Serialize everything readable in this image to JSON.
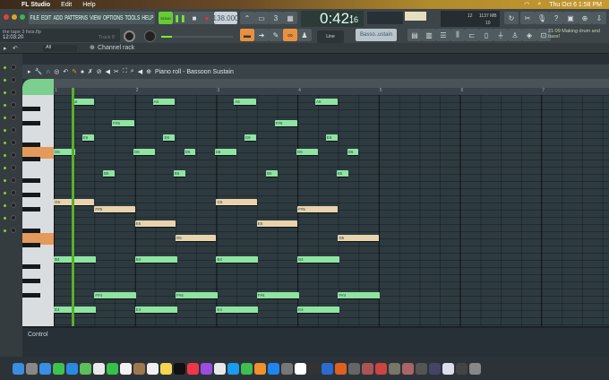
{
  "menubar": {
    "app": "FL Studio",
    "items": [
      "Edit",
      "Help"
    ],
    "datetime": "Thu Oct 6  1:58 PM"
  },
  "main_menu": [
    "FILE",
    "EDIT",
    "ADD",
    "PATTERNS",
    "VIEW",
    "OPTIONS",
    "TOOLS",
    "HELP"
  ],
  "transport": {
    "tempo": "138.000",
    "time": "0:42:",
    "time_small": "16",
    "mode": "SONG"
  },
  "song": {
    "file": "the tape 3 fixis.flp",
    "time": "12:03:20",
    "track": "Track 8"
  },
  "cpu": {
    "voices": "12",
    "memory": "1137 MB",
    "polyphony": "10"
  },
  "snap": "Line",
  "instrument": "Basso..ustain",
  "hint": "21:09  Making drum and bass!",
  "channel_rack": {
    "title": "Channel rack",
    "filter": "All"
  },
  "piano_roll": {
    "title": "Piano roll - Bassoon Sustain",
    "bars": [
      "1",
      "2",
      "3",
      "4",
      "5",
      "6",
      "7"
    ],
    "control_label": "Control"
  },
  "pitches": [
    "A6",
    "G#6",
    "G6",
    "F#6",
    "F6",
    "E6",
    "D#6",
    "D6",
    "C#6",
    "C6",
    "B5",
    "A#5",
    "A5",
    "G#5",
    "G5",
    "F#5",
    "F5",
    "E5",
    "D#5",
    "D5",
    "C#5",
    "C5",
    "B4",
    "A#4",
    "A4",
    "G#4",
    "G4",
    "F#4",
    "F4",
    "E4"
  ],
  "notes": [
    {
      "p": "A6",
      "s": 3.5,
      "l": 4.4,
      "c": "g"
    },
    {
      "p": "A6",
      "s": 19.5,
      "l": 4.4,
      "c": "g"
    },
    {
      "p": "A6",
      "s": 35.5,
      "l": 4.4,
      "c": "g"
    },
    {
      "p": "A6",
      "s": 51.5,
      "l": 4.4,
      "c": "g"
    },
    {
      "p": "F#6",
      "s": 11.5,
      "l": 4.4,
      "c": "g"
    },
    {
      "p": "F#6",
      "s": 43.5,
      "l": 4.4,
      "c": "g"
    },
    {
      "p": "E6",
      "s": 5.6,
      "l": 2.3,
      "c": "g"
    },
    {
      "p": "E6",
      "s": 21.6,
      "l": 2.3,
      "c": "g"
    },
    {
      "p": "E6",
      "s": 37.6,
      "l": 2.3,
      "c": "g"
    },
    {
      "p": "E6",
      "s": 53.6,
      "l": 2.3,
      "c": "g"
    },
    {
      "p": "D6",
      "s": 0,
      "l": 4.3,
      "c": "g"
    },
    {
      "p": "D6",
      "s": 15.7,
      "l": 4.3,
      "c": "g"
    },
    {
      "p": "D6",
      "s": 25.7,
      "l": 2.1,
      "c": "g"
    },
    {
      "p": "D6",
      "s": 31.7,
      "l": 4.3,
      "c": "g"
    },
    {
      "p": "D6",
      "s": 47.8,
      "l": 4.3,
      "c": "g"
    },
    {
      "p": "D6",
      "s": 57.8,
      "l": 2.1,
      "c": "g"
    },
    {
      "p": "B5",
      "s": 9.7,
      "l": 2.3,
      "c": "g"
    },
    {
      "p": "B5",
      "s": 23.6,
      "l": 2.3,
      "c": "g"
    },
    {
      "p": "B5",
      "s": 41.8,
      "l": 2.3,
      "c": "g"
    },
    {
      "p": "B5",
      "s": 55.7,
      "l": 2.3,
      "c": "g"
    },
    {
      "p": "G5",
      "s": 0,
      "l": 8,
      "c": "t"
    },
    {
      "p": "G5",
      "s": 32,
      "l": 8,
      "c": "t"
    },
    {
      "p": "F#5",
      "s": 8,
      "l": 8,
      "c": "t"
    },
    {
      "p": "F#5",
      "s": 48,
      "l": 8,
      "c": "t"
    },
    {
      "p": "E5",
      "s": 16,
      "l": 8,
      "c": "t"
    },
    {
      "p": "E5",
      "s": 40,
      "l": 8,
      "c": "t"
    },
    {
      "p": "D5",
      "s": 24,
      "l": 8,
      "c": "t"
    },
    {
      "p": "D5",
      "s": 56,
      "l": 8,
      "c": "t"
    },
    {
      "p": "B4",
      "s": 0,
      "l": 8.3,
      "c": "g"
    },
    {
      "p": "B4",
      "s": 16,
      "l": 8.3,
      "c": "g"
    },
    {
      "p": "B4",
      "s": 32,
      "l": 8.3,
      "c": "g"
    },
    {
      "p": "B4",
      "s": 48,
      "l": 8.3,
      "c": "g"
    },
    {
      "p": "F#4",
      "s": 8,
      "l": 8.3,
      "c": "g"
    },
    {
      "p": "F#4",
      "s": 24,
      "l": 8.3,
      "c": "g"
    },
    {
      "p": "F#4",
      "s": 40,
      "l": 8.3,
      "c": "g"
    },
    {
      "p": "F#4",
      "s": 56,
      "l": 8.3,
      "c": "g"
    },
    {
      "p": "E4",
      "s": 0,
      "l": 8.3,
      "c": "g"
    },
    {
      "p": "E4",
      "s": 16,
      "l": 8.3,
      "c": "g"
    },
    {
      "p": "E4",
      "s": 32,
      "l": 8.3,
      "c": "g"
    },
    {
      "p": "E4",
      "s": 48,
      "l": 8.3,
      "c": "g"
    }
  ],
  "dock_colors": [
    "#3b8de0",
    "#888",
    "#3a8ee6",
    "#3fc34f",
    "#2a8ae0",
    "#5bbf5b",
    "#e9e9e9",
    "#35c24b",
    "#f2f2f2",
    "#a07850",
    "#f0f0f0",
    "#f5d451",
    "#111",
    "#f0374a",
    "#9b4de0",
    "#e8e8e8",
    "#1a9bf0",
    "#3fbf4f",
    "#f0902e",
    "#1e86f0",
    "#777",
    "#fff",
    "#333",
    "#2a6bd0",
    "#e06020",
    "#666",
    "#a55",
    "#c44",
    "#776",
    "#a66",
    "#555",
    "#446",
    "#dde",
    "#444",
    "#888"
  ]
}
